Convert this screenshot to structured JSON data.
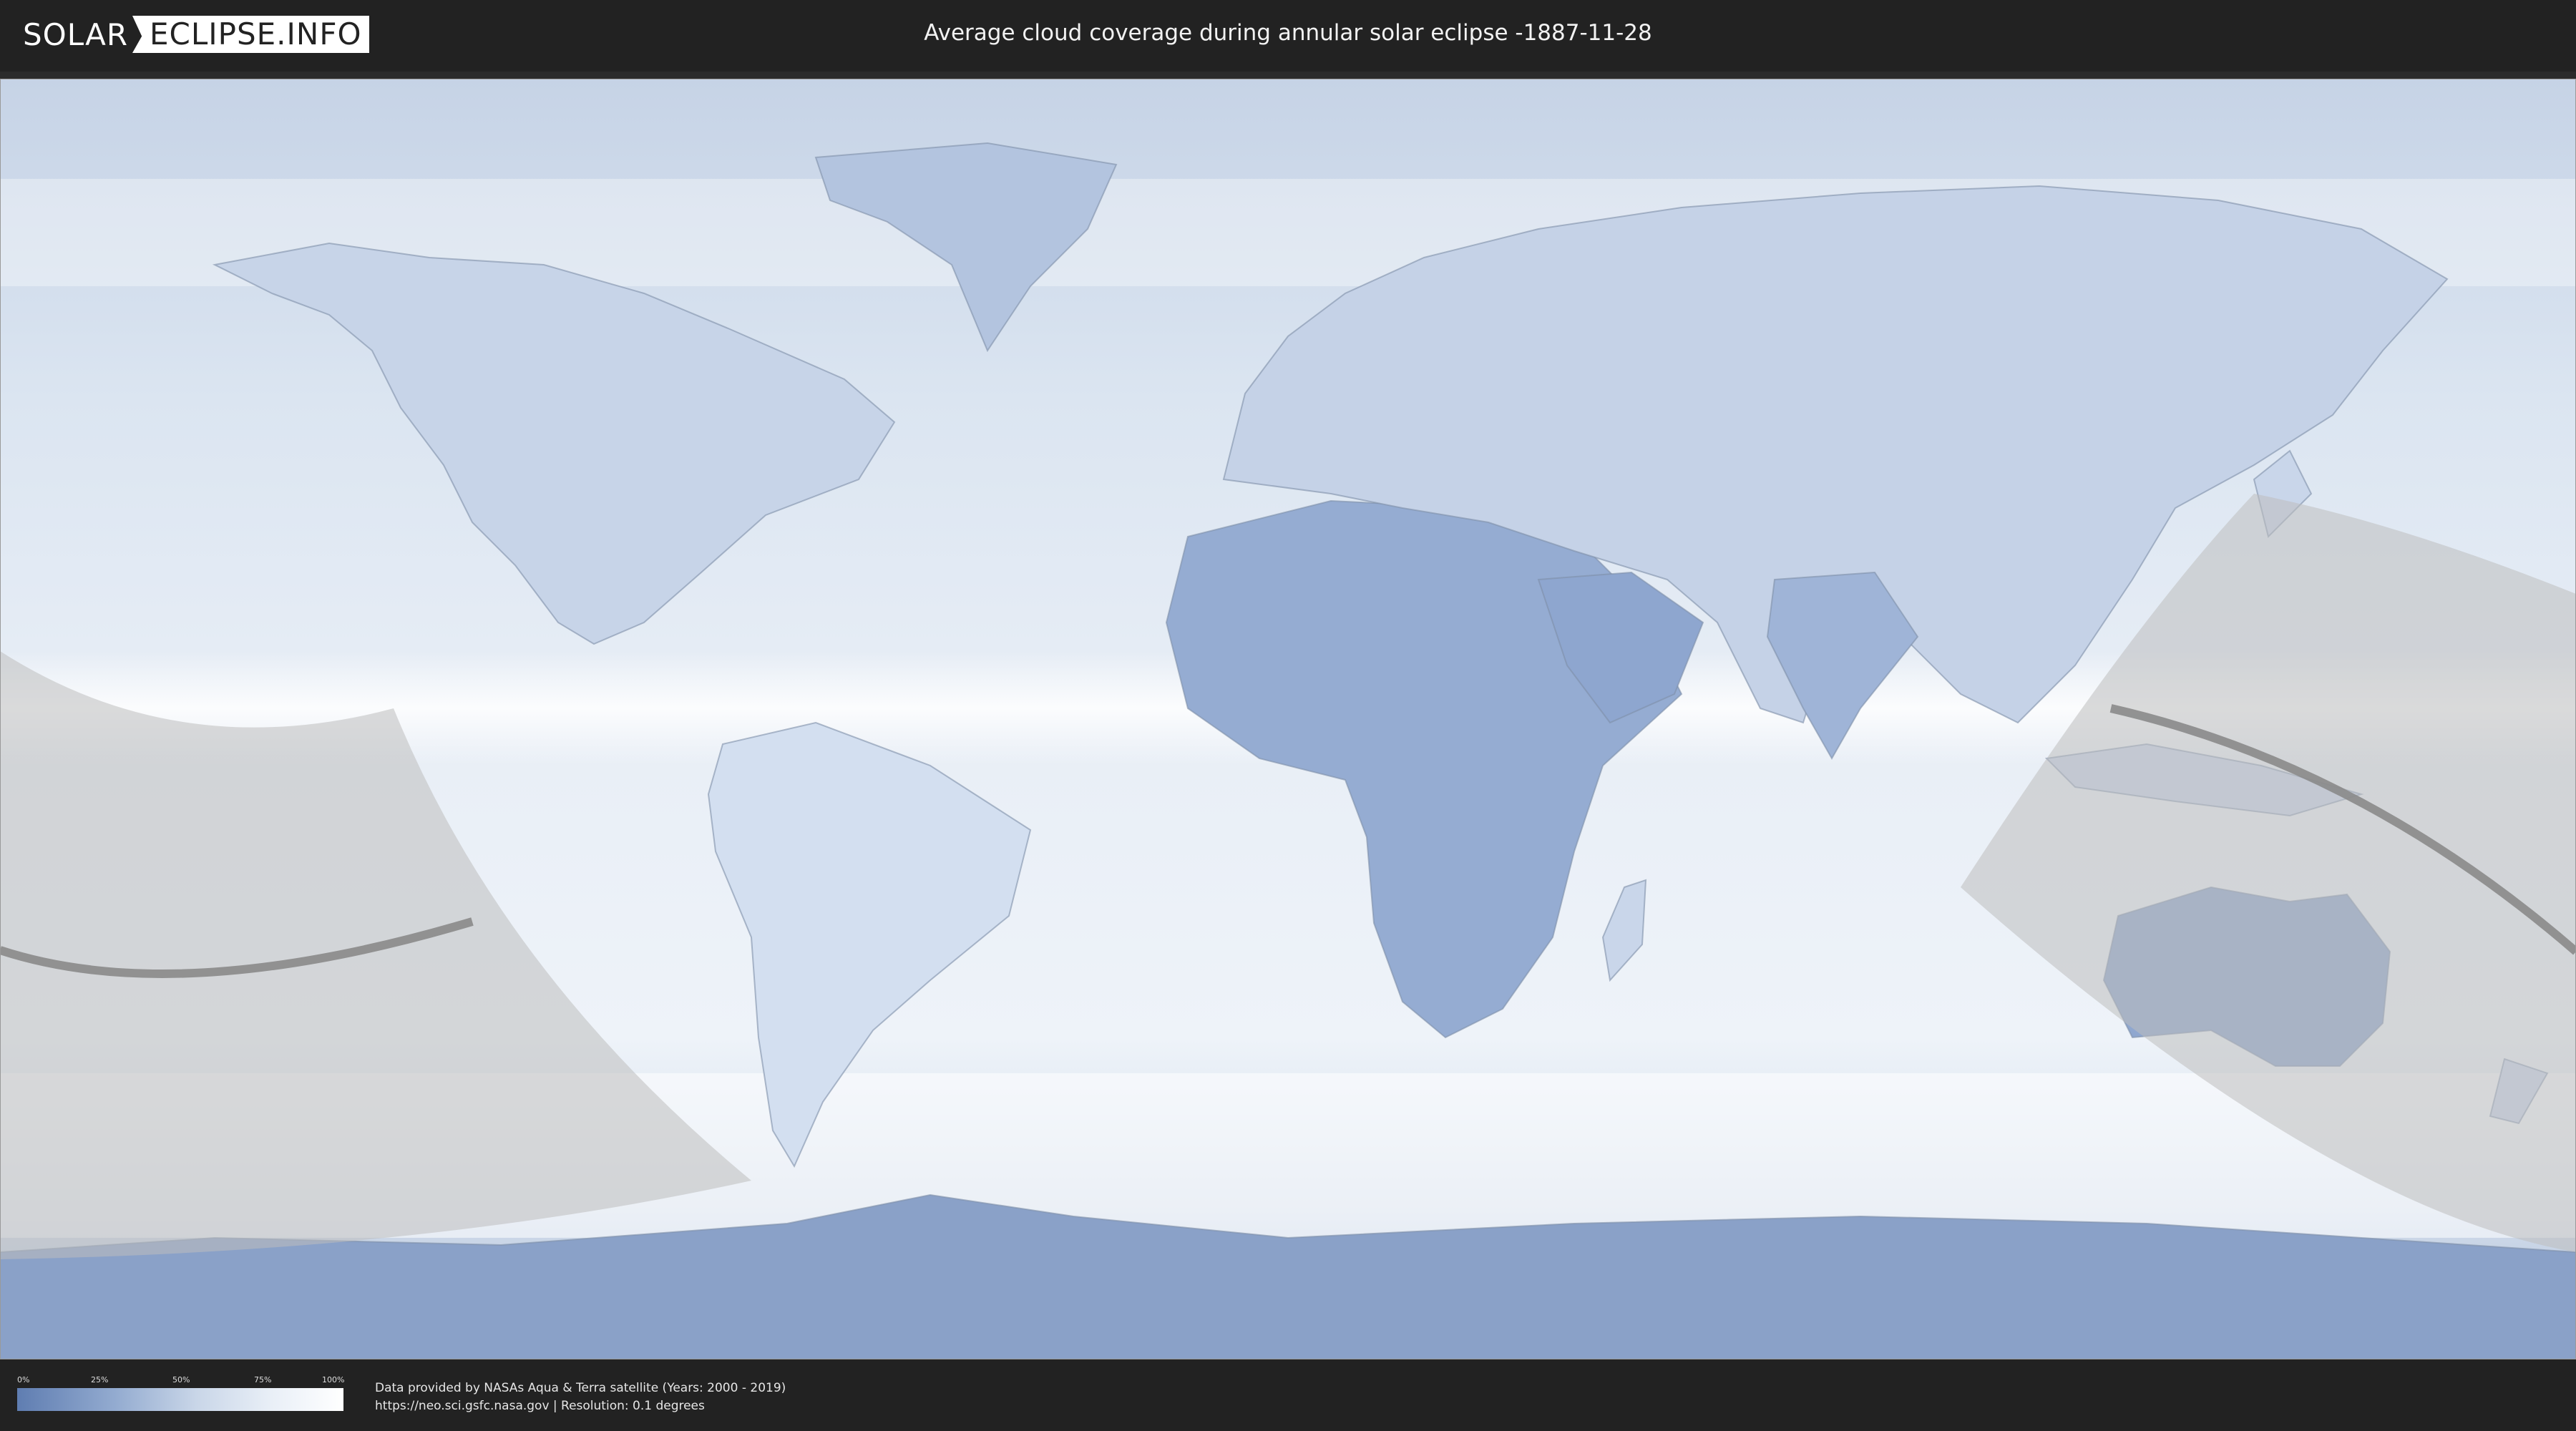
{
  "header": {
    "logo_left": "SOLAR",
    "logo_right": "ECLIPSE.INFO",
    "title": "Average cloud coverage during annular solar eclipse -1887-11-28"
  },
  "legend": {
    "ticks": [
      "0%",
      "25%",
      "50%",
      "75%",
      "100%"
    ],
    "colors": {
      "low": "#5f7db1",
      "high": "#ffffff"
    }
  },
  "footer": {
    "credit_line1": "Data provided by NASAs Aqua & Terra satellite (Years: 2000 - 2019)",
    "credit_line2": "https://neo.sci.gsfc.nasa.gov | Resolution: 0.1 degrees"
  },
  "map": {
    "projection": "equirectangular world map",
    "eclipse_shadow_color": "#bdbdbd",
    "central_line_color": "#8a8a8a"
  }
}
